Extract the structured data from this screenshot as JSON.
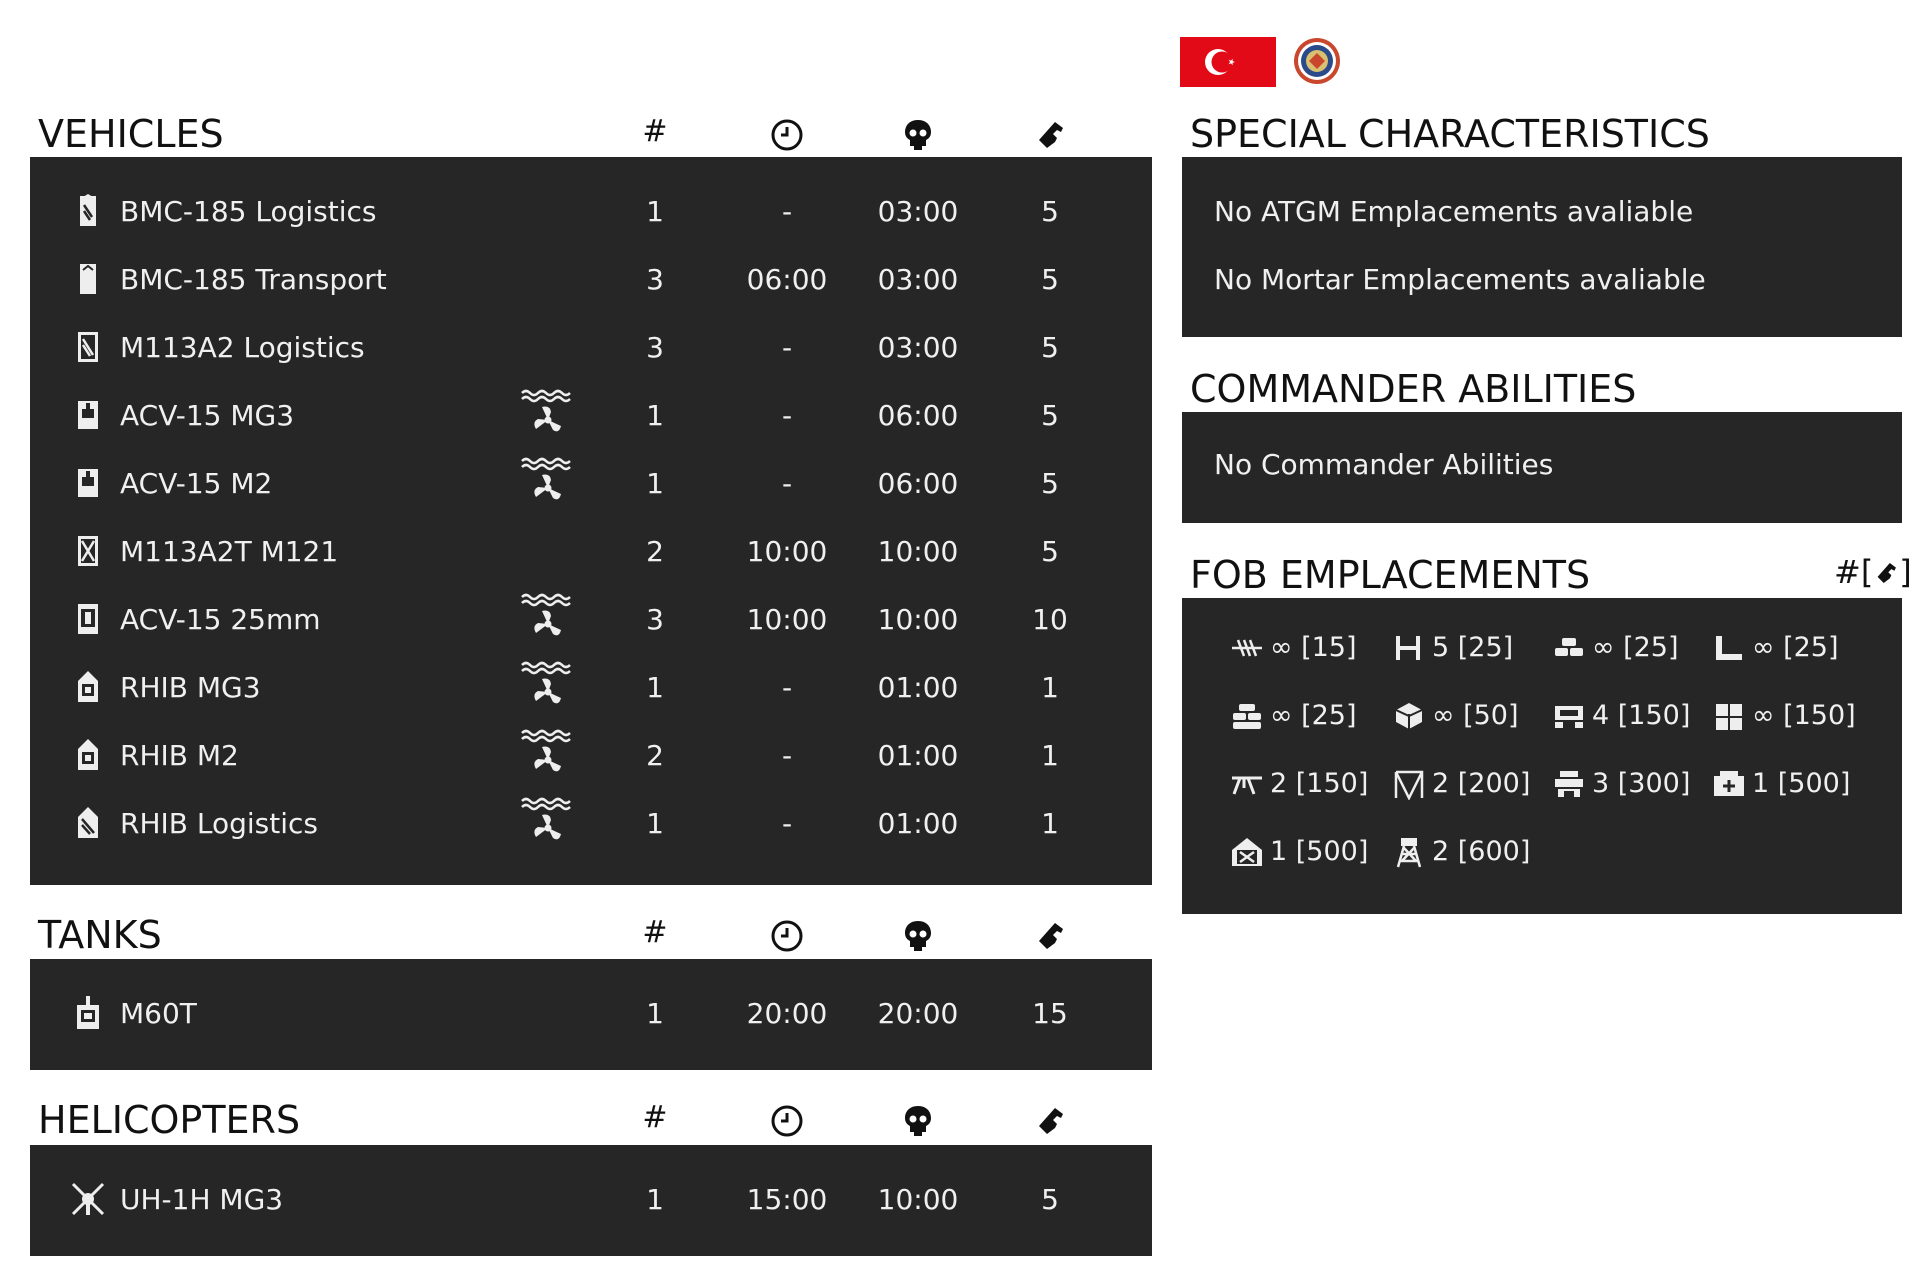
{
  "colors": {
    "panel": "#262626",
    "text_light": "#f0f0f0",
    "flag_red": "#e30a17"
  },
  "headers": {
    "count": "#"
  },
  "vehicles": {
    "title": "VEHICLES",
    "rows": [
      {
        "name": "BMC-185 Logistics",
        "icon": "logistics-truck-icon",
        "amphibious": false,
        "count": "1",
        "delay": "-",
        "respawn": "03:00",
        "tickets": "5"
      },
      {
        "name": "BMC-185 Transport",
        "icon": "transport-truck-icon",
        "amphibious": false,
        "count": "3",
        "delay": "06:00",
        "respawn": "03:00",
        "tickets": "5"
      },
      {
        "name": "M113A2 Logistics",
        "icon": "logistics-apc-icon",
        "amphibious": false,
        "count": "3",
        "delay": "-",
        "respawn": "03:00",
        "tickets": "5"
      },
      {
        "name": "ACV-15 MG3",
        "icon": "apc-icon",
        "amphibious": true,
        "count": "1",
        "delay": "-",
        "respawn": "06:00",
        "tickets": "5"
      },
      {
        "name": "ACV-15 M2",
        "icon": "apc-icon",
        "amphibious": true,
        "count": "1",
        "delay": "-",
        "respawn": "06:00",
        "tickets": "5"
      },
      {
        "name": "M113A2T M121",
        "icon": "mortar-carrier-icon",
        "amphibious": false,
        "count": "2",
        "delay": "10:00",
        "respawn": "10:00",
        "tickets": "5"
      },
      {
        "name": "ACV-15 25mm",
        "icon": "ifv-icon",
        "amphibious": true,
        "count": "3",
        "delay": "10:00",
        "respawn": "10:00",
        "tickets": "10"
      },
      {
        "name": "RHIB MG3",
        "icon": "boat-icon",
        "amphibious": true,
        "count": "1",
        "delay": "-",
        "respawn": "01:00",
        "tickets": "1"
      },
      {
        "name": "RHIB M2",
        "icon": "boat-icon",
        "amphibious": true,
        "count": "2",
        "delay": "-",
        "respawn": "01:00",
        "tickets": "1"
      },
      {
        "name": "RHIB Logistics",
        "icon": "logistics-boat-icon",
        "amphibious": true,
        "count": "1",
        "delay": "-",
        "respawn": "01:00",
        "tickets": "1"
      }
    ]
  },
  "tanks": {
    "title": "TANKS",
    "rows": [
      {
        "name": "M60T",
        "icon": "tank-icon",
        "count": "1",
        "delay": "20:00",
        "respawn": "20:00",
        "tickets": "15"
      }
    ]
  },
  "helicopters": {
    "title": "HELICOPTERS",
    "rows": [
      {
        "name": "UH-1H MG3",
        "icon": "helicopter-icon",
        "count": "1",
        "delay": "15:00",
        "respawn": "10:00",
        "tickets": "5"
      }
    ]
  },
  "special": {
    "title": "SPECIAL CHARACTERISTICS",
    "items": [
      "No ATGM Emplacements avaliable",
      "No Mortar Emplacements avaliable"
    ]
  },
  "commander": {
    "title": "COMMANDER ABILITIES",
    "items": [
      "No Commander Abilities"
    ]
  },
  "fob": {
    "title": "FOB EMPLACEMENTS",
    "header_label": "#[",
    "header_label_end": "]",
    "items": [
      {
        "icon": "razor-wire-icon",
        "value": "∞ [15]"
      },
      {
        "icon": "tank-trap-icon",
        "value": "5 [25]"
      },
      {
        "icon": "sandbag-wall-icon",
        "value": "∞ [25]"
      },
      {
        "icon": "sandbag-corner-icon",
        "value": "∞ [25]"
      },
      {
        "icon": "sandbag-low-icon",
        "value": "∞ [25]"
      },
      {
        "icon": "ammo-crate-icon",
        "value": "∞ [50]"
      },
      {
        "icon": "hmg-bunker-icon",
        "value": "4 [150]"
      },
      {
        "icon": "hesco-icon",
        "value": "∞ [150]"
      },
      {
        "icon": "machine-gun-icon",
        "value": "2 [150]"
      },
      {
        "icon": "camo-net-icon",
        "value": "2 [200]"
      },
      {
        "icon": "bunker-icon",
        "value": "3 [300]"
      },
      {
        "icon": "medical-bunker-icon",
        "value": "1 [500]"
      },
      {
        "icon": "repair-station-icon",
        "value": "1 [500]"
      },
      {
        "icon": "watchtower-icon",
        "value": "2 [600]"
      }
    ]
  }
}
